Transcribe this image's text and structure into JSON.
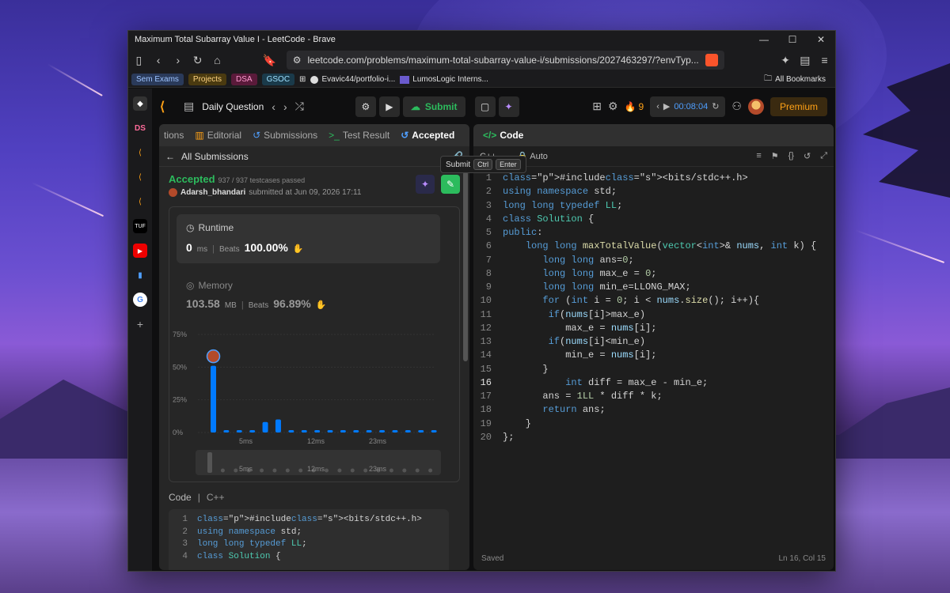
{
  "window": {
    "title": "Maximum Total Subarray Value I - LeetCode - Brave"
  },
  "browser": {
    "url": "leetcode.com/problems/maximum-total-subarray-value-i/submissions/2027463297/?envTyp...",
    "bookmarks": [
      {
        "label": "Sem Exams",
        "bg": "#2a3a5a",
        "fg": "#9ec4ff"
      },
      {
        "label": "Projects",
        "bg": "#4a3a10",
        "fg": "#ffd480"
      },
      {
        "label": "DSA",
        "bg": "#5a1a3a",
        "fg": "#ff9ad0"
      },
      {
        "label": "GSOC",
        "bg": "#1a3a4a",
        "fg": "#9ee0ff"
      }
    ],
    "bookmark_links": [
      "Evavic44/portfolio-i...",
      "LumosLogic Interns..."
    ],
    "all_bookmarks": "All Bookmarks"
  },
  "sidebar_apps": [
    "DS",
    "TUF"
  ],
  "leetcode": {
    "daily_question": "Daily Question",
    "submit_label": "Submit",
    "streak": "9",
    "timer": "00:08:04",
    "premium": "Premium",
    "tabs": [
      "tions",
      "Editorial",
      "Submissions",
      "Test Result",
      "Accepted"
    ],
    "code_tab": "Code",
    "tooltip": {
      "label": "Submit",
      "keys": [
        "Ctrl",
        "Enter"
      ]
    },
    "all_submissions": "All Submissions",
    "result": {
      "status": "Accepted",
      "testcases": "937 / 937 testcases passed",
      "user": "Adarsh_bhandari",
      "submitted": "submitted at Jun 09, 2026 17:11"
    },
    "runtime": {
      "label": "Runtime",
      "value": "0",
      "unit": "ms",
      "beats_label": "Beats",
      "beats": "100.00%"
    },
    "memory": {
      "label": "Memory",
      "value": "103.58",
      "unit": "MB",
      "beats_label": "Beats",
      "beats": "96.89%"
    },
    "code_label": "Code",
    "code_lang": "C++",
    "preview_lines": [
      "#include<bits/stdc++.h>",
      "using namespace std;",
      "long long typedef LL;",
      "class Solution {"
    ],
    "editor": {
      "language": "C++",
      "mode": "Auto",
      "saved": "Saved",
      "cursor": "Ln 16, Col 15",
      "current_line": 16
    }
  },
  "chart_data": {
    "type": "bar",
    "title": "",
    "ylabel": "",
    "yticks": [
      "75%",
      "50%",
      "25%",
      "0%"
    ],
    "ylim": [
      0,
      75
    ],
    "xticks": [
      "5ms",
      "12ms",
      "23ms"
    ],
    "values": [
      51,
      1,
      1,
      1,
      8,
      10,
      1,
      1,
      1,
      1,
      1,
      1,
      1,
      1,
      1,
      1,
      1,
      1
    ],
    "highlight_index": 0,
    "accent": "#007aff"
  },
  "code": [
    "#include<bits/stdc++.h>",
    "using namespace std;",
    "long long typedef LL;",
    "class Solution {",
    "public:",
    "    long long maxTotalValue(vector<int>& nums, int k) {",
    "       long long ans=0;",
    "       long long max_e = 0;",
    "       long long min_e=LLONG_MAX;",
    "       for (int i = 0; i < nums.size(); i++){",
    "        if(nums[i]>max_e)",
    "           max_e = nums[i];",
    "        if(nums[i]<min_e)",
    "           min_e = nums[i];",
    "       }",
    "           int diff = max_e - min_e;",
    "       ans = 1LL * diff * k;",
    "       return ans;",
    "    }",
    "};"
  ]
}
